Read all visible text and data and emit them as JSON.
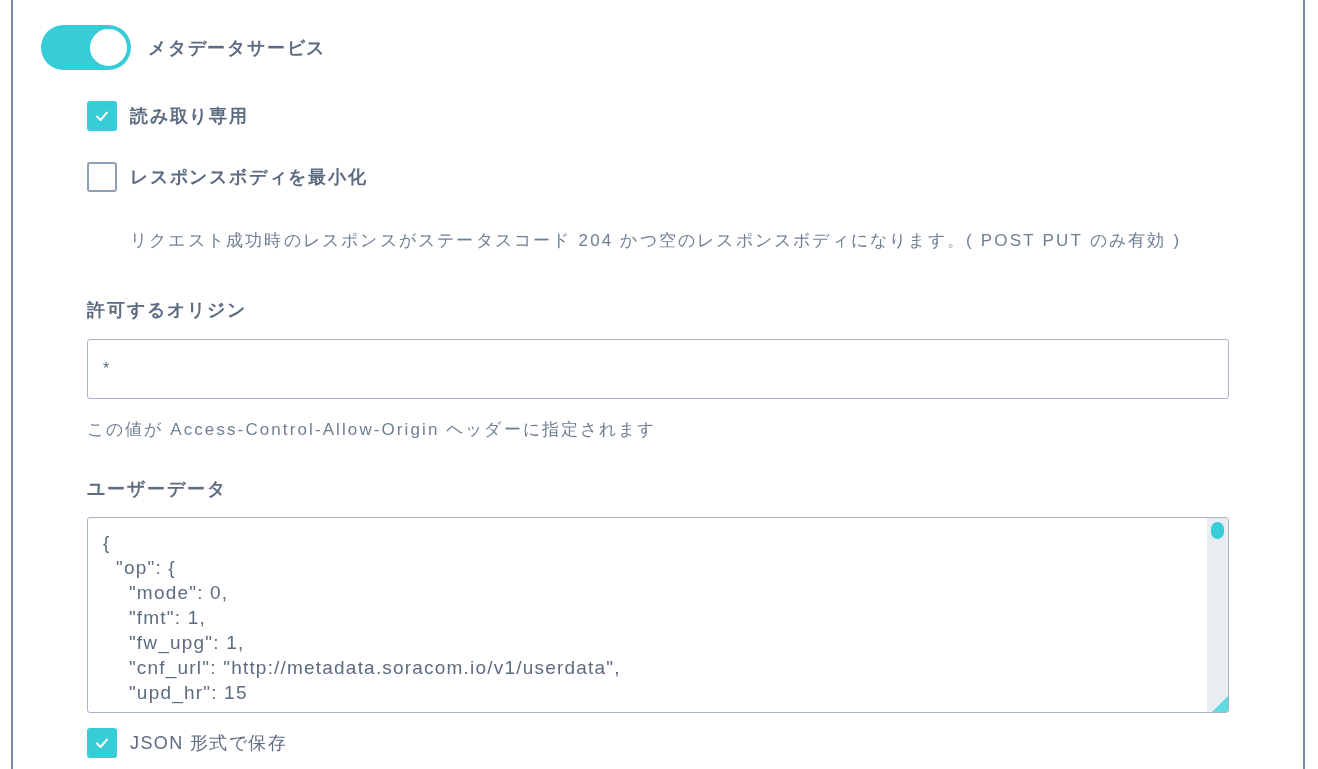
{
  "metadata_service": {
    "label": "メタデータサービス",
    "on": true
  },
  "options": [
    {
      "label": "読み取り専用",
      "checked": true
    },
    {
      "label": "レスポンスボディを最小化",
      "checked": false,
      "description": "リクエスト成功時のレスポンスがステータスコード 204 かつ空のレスポンスボディになります。( POST PUT のみ有効 )"
    }
  ],
  "allowed_origin": {
    "label": "許可するオリジン",
    "value": "*",
    "help": "この値が Access-Control-Allow-Origin ヘッダーに指定されます"
  },
  "user_data": {
    "label": "ユーザーデータ",
    "lines": [
      "{",
      "  \"op\": {",
      "    \"mode\": 0,",
      "    \"fmt\": 1,",
      "    \"fw_upg\": 1,",
      "    \"cnf_url\": \"http://metadata.soracom.io/v1/userdata\",",
      "    \"upd_hr\": 15"
    ]
  },
  "save_as_json": {
    "label": "JSON 形式で保存",
    "checked": true
  }
}
